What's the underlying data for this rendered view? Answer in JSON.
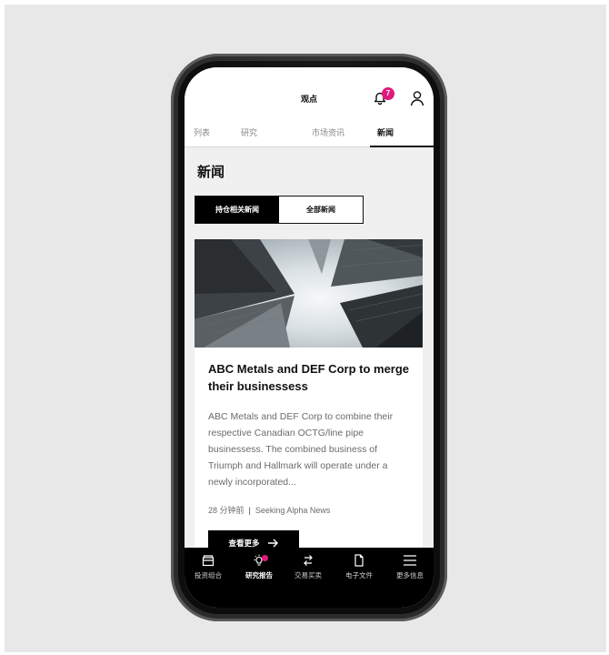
{
  "header": {
    "title": "观点",
    "notification_count": "7"
  },
  "tabs": [
    {
      "label": "列表"
    },
    {
      "label": "研究"
    },
    {
      "label": "市场资讯"
    },
    {
      "label": "新闻",
      "active": true
    }
  ],
  "news": {
    "title": "新闻",
    "filter": {
      "holdings_label": "持仓相关新闻",
      "all_label": "全部新闻",
      "selected": "持仓相关新闻"
    }
  },
  "article": {
    "headline": "ABC Metals and DEF Corp to merge their businessess",
    "body": "ABC Metals and DEF Corp to combine their respective Canadian OCTG/line pipe businessess. The combined business of Triumph and Hallmark will operate under a newly incorporated...",
    "time": "28 分钟前",
    "separator": "|",
    "source": "Seeking Alpha News",
    "more_label": "查看更多",
    "more_icon": "arrow-right-icon",
    "image_icon": "skyscrapers-photo"
  },
  "bottom_nav": [
    {
      "label": "投资组合",
      "icon": "folder-icon"
    },
    {
      "label": "研究报告",
      "icon": "lightbulb-icon",
      "active": true
    },
    {
      "label": "交易买卖",
      "icon": "swap-icon"
    },
    {
      "label": "电子文件",
      "icon": "document-icon"
    },
    {
      "label": "更多信息",
      "icon": "menu-icon"
    }
  ],
  "colors": {
    "accent": "#e0197d",
    "background": "#e8e8e8",
    "screen": "#f0f0f0",
    "nav": "#000000"
  }
}
